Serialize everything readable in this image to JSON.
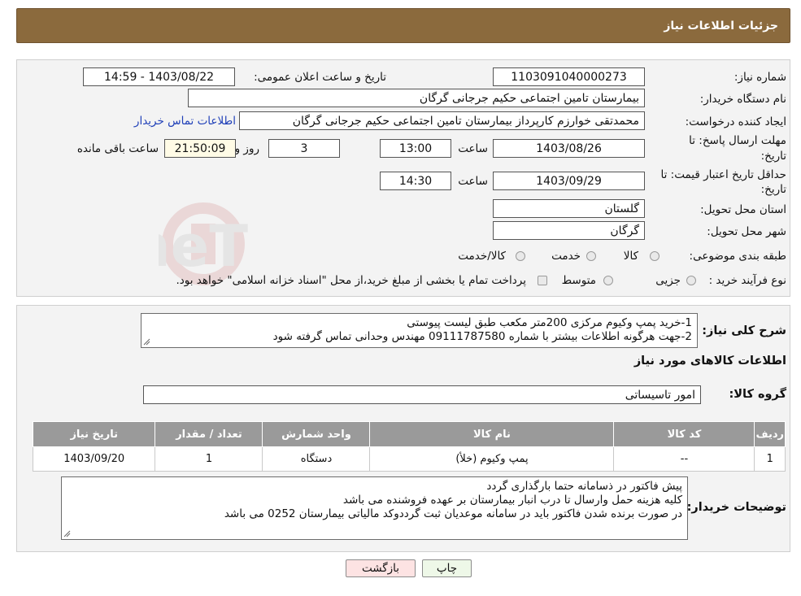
{
  "header": {
    "title": "جزئیات اطلاعات نیاز"
  },
  "form": {
    "need_number_label": "شماره نیاز:",
    "need_number": "1103091040000273",
    "announce_label": "تاریخ و ساعت اعلان عمومی:",
    "announce_value": "1403/08/22 - 14:59",
    "buyer_org_label": "نام دستگاه خریدار:",
    "buyer_org": "بیمارستان تامین اجتماعی حکیم جرجانی گرگان",
    "creator_label": "ایجاد کننده درخواست:",
    "creator": "محمدتقی خوارزم کارپرداز بیمارستان تامین اجتماعی حکیم جرجانی گرگان",
    "contact_link": "اطلاعات تماس خریدار",
    "deadline_label_1": "مهلت ارسال پاسخ: تا",
    "deadline_label_2": "تاریخ:",
    "deadline_date": "1403/08/26",
    "time_label": "ساعت",
    "deadline_time": "13:00",
    "days_value": "3",
    "days_label": "روز و",
    "remaining_value": "21:50:09",
    "remaining_label": "ساعت باقی مانده",
    "validity_label_1": "حداقل تاریخ اعتبار قیمت: تا",
    "validity_label_2": "تاریخ:",
    "validity_date": "1403/09/29",
    "validity_time": "14:30",
    "province_label": "استان محل تحویل:",
    "province": "گلستان",
    "city_label": "شهر محل تحویل:",
    "city": "گرگان",
    "category_label": "طبقه بندی موضوعی:",
    "category_options": [
      "کالا",
      "خدمت",
      "کالا/خدمت"
    ],
    "process_label": "نوع فرآیند خرید :",
    "process_options": [
      "جزیی",
      "متوسط"
    ],
    "process_note": "پرداخت تمام یا بخشی از مبلغ خرید،از محل \"اسناد خزانه اسلامی\" خواهد بود."
  },
  "description": {
    "label": "شرح کلی نیاز:",
    "lines": [
      "1-خرید پمپ وکیوم مرکزی  200متر مکعب طبق لیست پیوستی",
      "2-جهت هرگونه اطلاعات بیشتر با شماره 09111787580 مهندس وحدانی تماس گرفته شود"
    ]
  },
  "goods": {
    "section_title": "اطلاعات کالاهای مورد نیاز",
    "group_label": "گروه کالا:",
    "group_value": "امور تاسیساتی",
    "columns": [
      "ردیف",
      "کد کالا",
      "نام کالا",
      "واحد شمارش",
      "تعداد / مقدار",
      "تاریخ نیاز"
    ],
    "rows": [
      [
        "1",
        "--",
        "پمپ وکیوم (خلأ)",
        "دستگاه",
        "1",
        "1403/09/20"
      ]
    ]
  },
  "buyer_notes": {
    "label": "توضیحات خریدار:",
    "lines": [
      "پیش فاکتور در ذسامانه حتما بارگذاری گردد",
      "کلیه هزینه حمل وارسال تا درب انبار بیمارستان بر عهده فروشنده می باشد",
      "در صورت برنده شدن فاکتور باید در سامانه موعدیان ثبت گرددوکد مالیاتی بیمارستان 0252 می باشد"
    ]
  },
  "buttons": {
    "print": "چاپ",
    "back": "بازگشت"
  },
  "colors": {
    "header_bg": "#8b6a3d",
    "back_bg": "#fde3e3",
    "print_bg": "#eef8e8"
  }
}
